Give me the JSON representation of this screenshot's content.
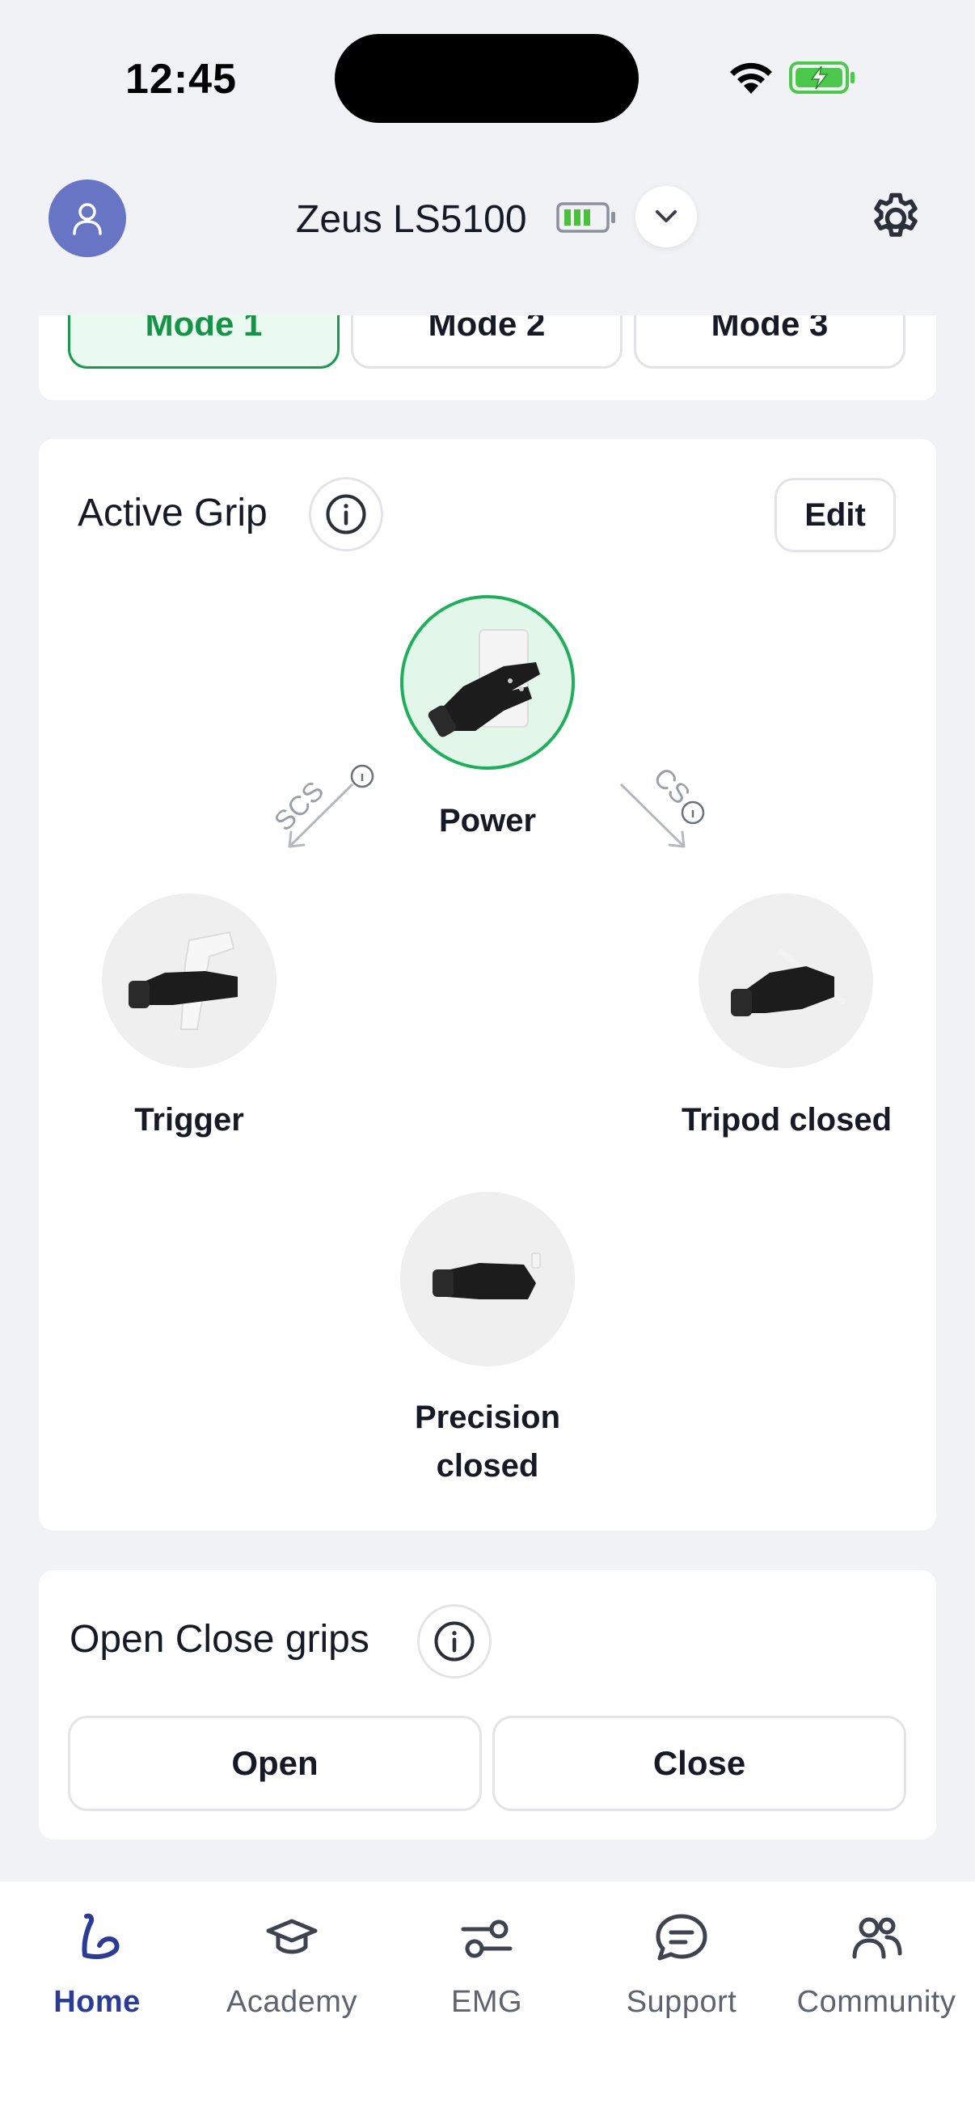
{
  "status_bar": {
    "time": "12:45"
  },
  "header": {
    "device_name": "Zeus LS5100",
    "icons": [
      "user-icon",
      "battery-icon",
      "chevron-down-icon",
      "gear-icon"
    ]
  },
  "modes": {
    "items": [
      {
        "label": "Mode 1",
        "active": true
      },
      {
        "label": "Mode 2",
        "active": false
      },
      {
        "label": "Mode 3",
        "active": false
      }
    ]
  },
  "active_grip": {
    "title": "Active Grip",
    "edit_label": "Edit",
    "grips": {
      "power": "Power",
      "trigger": "Trigger",
      "tripod": "Tripod closed",
      "precision_line1": "Precision",
      "precision_line2": "closed"
    },
    "transitions": {
      "left": "SCS",
      "right": "CS"
    }
  },
  "open_close": {
    "title": "Open Close grips",
    "open_label": "Open",
    "close_label": "Close"
  },
  "nav": {
    "items": [
      {
        "label": "Home",
        "icon": "arm-icon",
        "active": true
      },
      {
        "label": "Academy",
        "icon": "graduation-cap-icon",
        "active": false
      },
      {
        "label": "EMG",
        "icon": "sliders-icon",
        "active": false
      },
      {
        "label": "Support",
        "icon": "chat-bubble-icon",
        "active": false
      },
      {
        "label": "Community",
        "icon": "people-icon",
        "active": false
      }
    ]
  },
  "colors": {
    "accent_green": "#1fae5a",
    "brand_blue": "#2c3c94",
    "avatar_bg": "#6874c4",
    "battery_green": "#4cc94c"
  }
}
